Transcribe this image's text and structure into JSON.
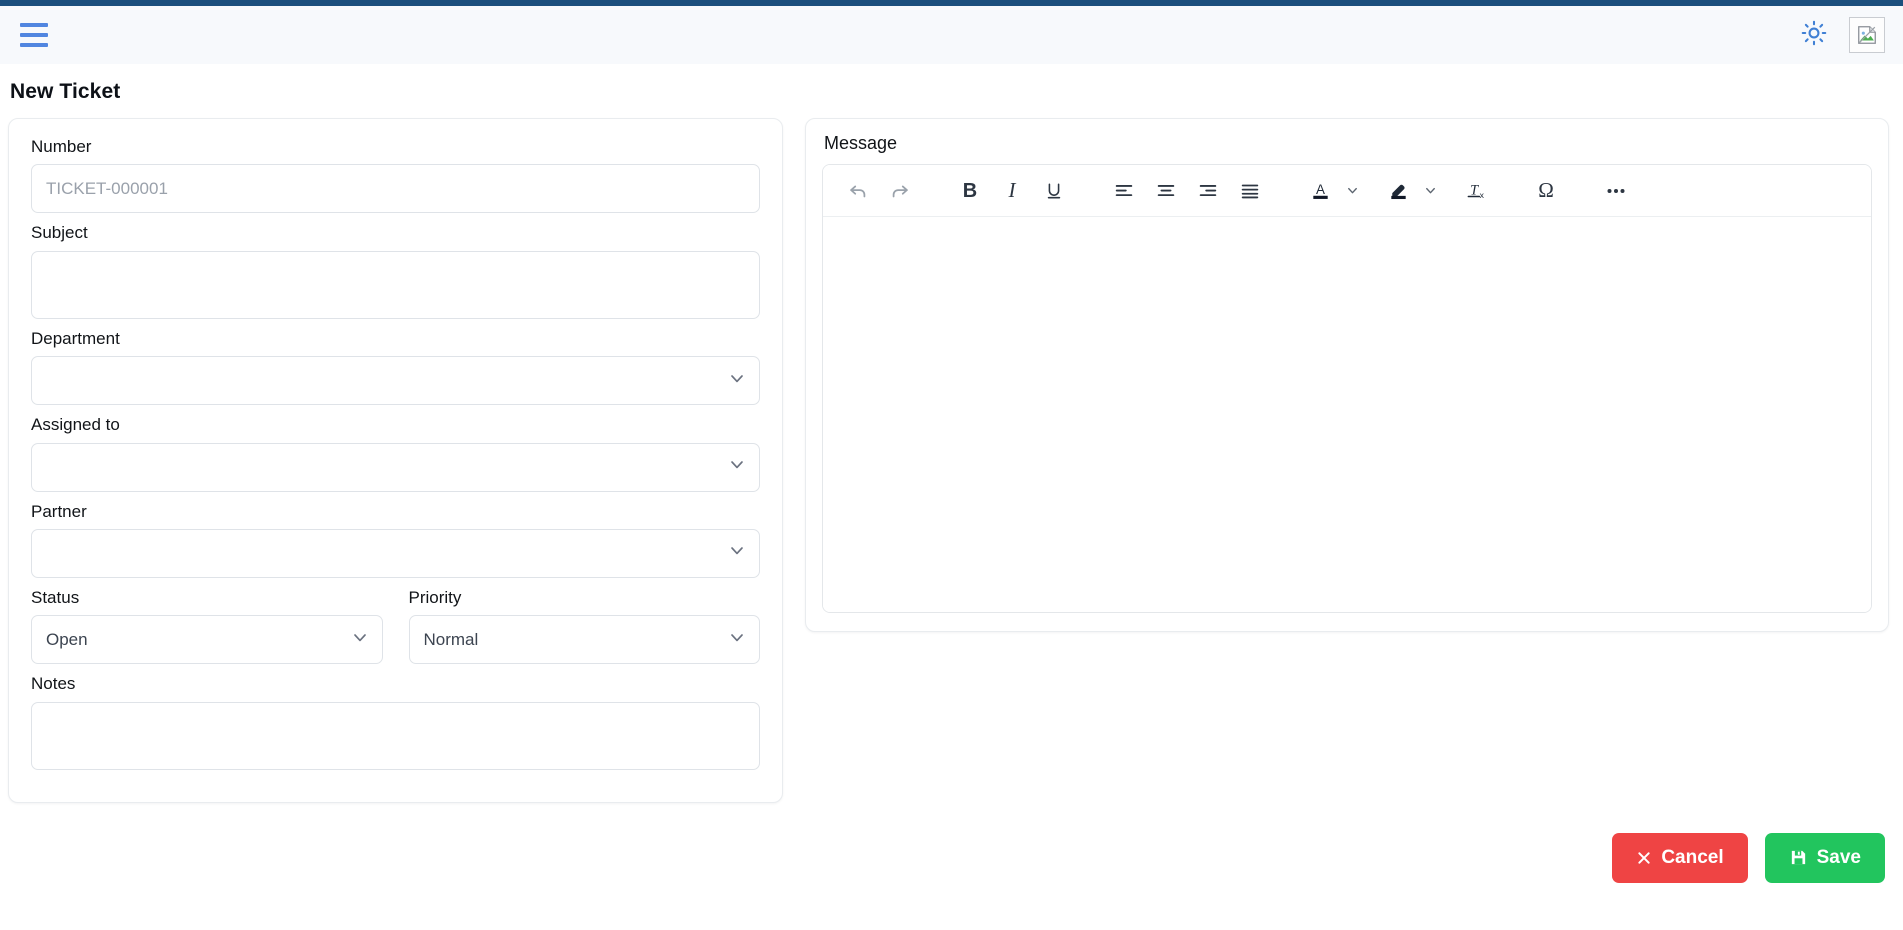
{
  "theme": {
    "accent_strip": "#1b4f7d",
    "header_bg": "#f7f9fc",
    "menu_icon_color": "#5186e0",
    "cancel_color": "#ef4444",
    "save_color": "#22c55e"
  },
  "header": {
    "menu_icon": "hamburger-menu-icon",
    "theme_toggle_icon": "sun-brightness-icon",
    "avatar_icon": "broken-image-placeholder-icon"
  },
  "page": {
    "title": "New Ticket"
  },
  "form": {
    "fields": [
      {
        "key": "number",
        "label": "Number",
        "type": "input",
        "value": "",
        "placeholder": "TICKET-000001"
      },
      {
        "key": "subject",
        "label": "Subject",
        "type": "textarea",
        "value": "",
        "placeholder": ""
      },
      {
        "key": "department",
        "label": "Department",
        "type": "select",
        "value": "",
        "placeholder": ""
      },
      {
        "key": "assigned_to",
        "label": "Assigned to",
        "type": "select",
        "value": "",
        "placeholder": ""
      },
      {
        "key": "partner",
        "label": "Partner",
        "type": "select",
        "value": "",
        "placeholder": ""
      },
      {
        "key": "status",
        "label": "Status",
        "type": "select",
        "value": "Open",
        "placeholder": ""
      },
      {
        "key": "priority",
        "label": "Priority",
        "type": "select",
        "value": "Normal",
        "placeholder": ""
      },
      {
        "key": "notes",
        "label": "Notes",
        "type": "textarea",
        "value": "",
        "placeholder": ""
      }
    ]
  },
  "message": {
    "label": "Message",
    "body_value": "",
    "toolbar": [
      {
        "name": "undo-icon",
        "label": "Undo",
        "state": "disabled"
      },
      {
        "name": "redo-icon",
        "label": "Redo",
        "state": "disabled"
      },
      {
        "name": "bold-icon",
        "label": "B",
        "state": "enabled"
      },
      {
        "name": "italic-icon",
        "label": "I",
        "state": "enabled"
      },
      {
        "name": "underline-icon",
        "label": "U",
        "state": "enabled"
      },
      {
        "name": "align-left-icon",
        "label": "Align left",
        "state": "enabled"
      },
      {
        "name": "align-center-icon",
        "label": "Align center",
        "state": "enabled"
      },
      {
        "name": "align-right-icon",
        "label": "Align right",
        "state": "enabled"
      },
      {
        "name": "align-justify-icon",
        "label": "Justify",
        "state": "enabled"
      },
      {
        "name": "font-color-icon",
        "label": "A",
        "state": "enabled"
      },
      {
        "name": "font-color-caret-icon",
        "label": "",
        "state": "enabled"
      },
      {
        "name": "highlight-color-icon",
        "label": "",
        "state": "enabled"
      },
      {
        "name": "highlight-caret-icon",
        "label": "",
        "state": "enabled"
      },
      {
        "name": "remove-format-icon",
        "label": "Tx",
        "state": "enabled"
      },
      {
        "name": "special-character-icon",
        "label": "Ω",
        "state": "enabled"
      },
      {
        "name": "more-options-icon",
        "label": "•••",
        "state": "enabled"
      }
    ]
  },
  "actions": {
    "cancel_label": "Cancel",
    "cancel_icon": "close-x-icon",
    "save_label": "Save",
    "save_icon": "floppy-disk-save-icon"
  }
}
